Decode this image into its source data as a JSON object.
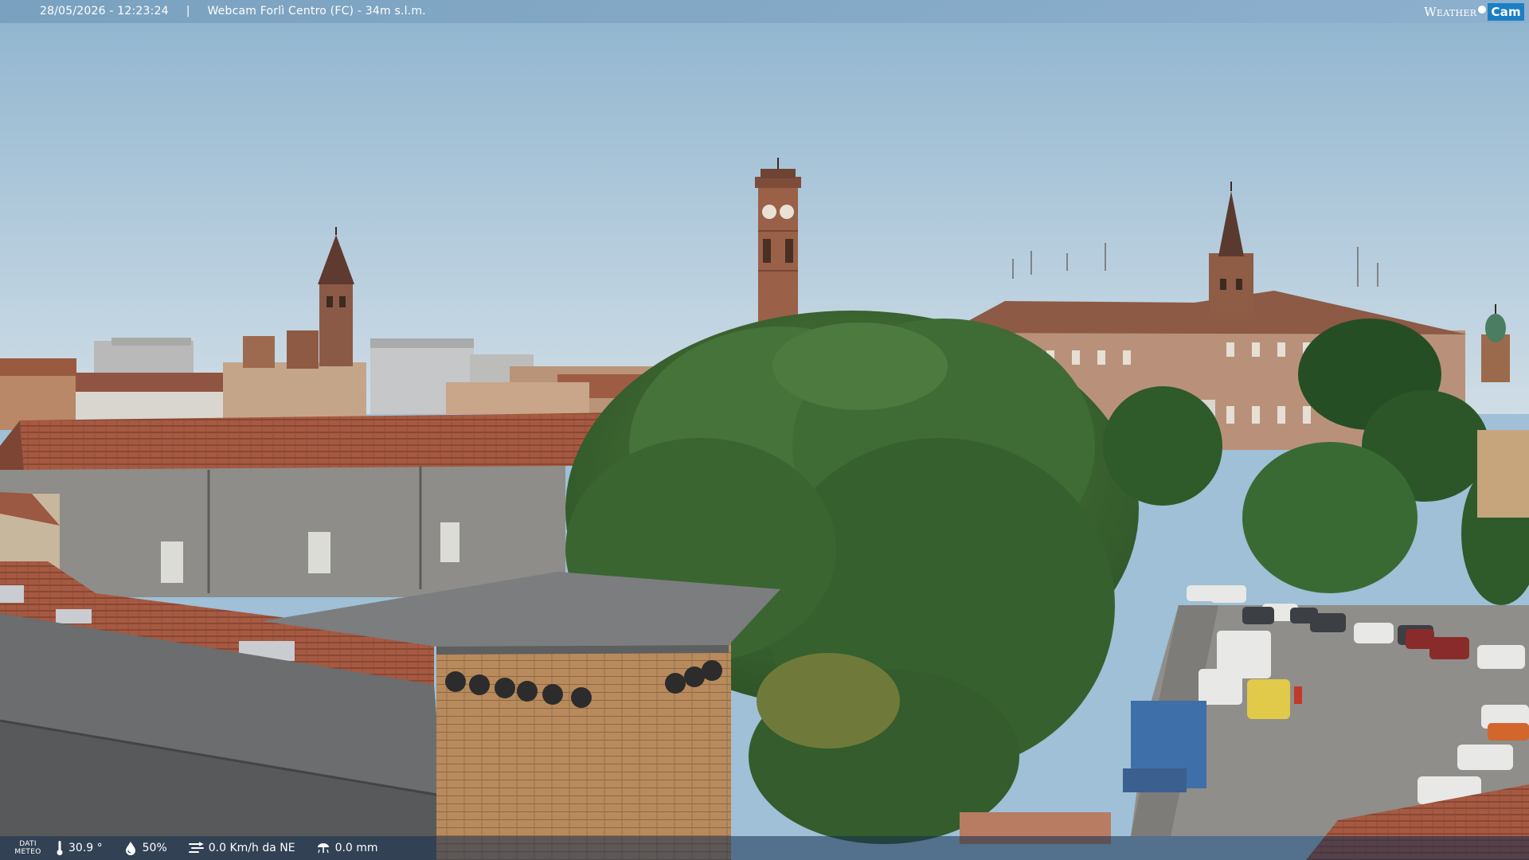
{
  "overlay": {
    "timestamp": "28/05/2026 - 12:23:24",
    "separator": "|",
    "camera_title": "Webcam Forlì Centro (FC) - 34m s.l.m.",
    "brand_part1": "Weather",
    "brand_part2": "Cam"
  },
  "weather": {
    "label_line1": "DATI",
    "label_line2": "METEO",
    "temperature": "30.9 °",
    "humidity": "50%",
    "wind": "0.0 Km/h da NE",
    "rain": "0.0 mm",
    "icons": [
      "thermometer-icon",
      "humidity-drop-icon",
      "wind-icon",
      "rain-gauge-icon"
    ]
  },
  "colors": {
    "sky_top": "#8fb4cf",
    "sky_bottom": "#c9dbe6",
    "roof_tiles": "#a4553b",
    "brick": "#b5865a",
    "foliage": "#3f6b34",
    "bar_top": "#7aa3c2",
    "bar_bottom": "#1c3a60",
    "brand_blue": "#1b7fc4"
  }
}
